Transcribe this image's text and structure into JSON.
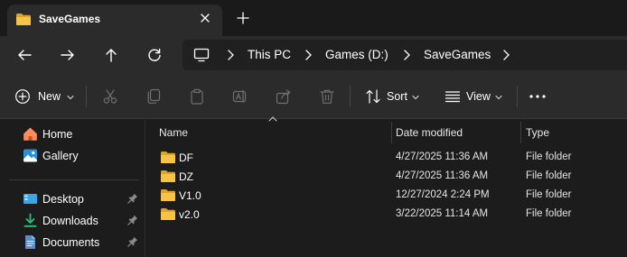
{
  "window": {
    "tab_title": "SaveGames",
    "tab_icon": "folder-icon",
    "colors": {
      "folder": "#f6c347",
      "folder_shade": "#dca52a",
      "accent": "#4cc2ff"
    }
  },
  "address": {
    "root_icon": "this-pc-icon",
    "crumbs": [
      "This PC",
      "Games (D:)",
      "SaveGames"
    ]
  },
  "toolbar": {
    "new_label": "New",
    "sort_label": "Sort",
    "view_label": "View"
  },
  "nav": {
    "quick": [
      {
        "label": "Home",
        "icon": "home-icon"
      },
      {
        "label": "Gallery",
        "icon": "gallery-icon"
      }
    ],
    "pinned": [
      {
        "label": "Desktop",
        "icon": "desktop-icon"
      },
      {
        "label": "Downloads",
        "icon": "downloads-icon"
      },
      {
        "label": "Documents",
        "icon": "documents-icon"
      }
    ]
  },
  "columns": {
    "name": "Name",
    "date": "Date modified",
    "type": "Type"
  },
  "files": [
    {
      "name": "DF",
      "date": "4/27/2025 11:36 AM",
      "type": "File folder"
    },
    {
      "name": "DZ",
      "date": "4/27/2025 11:36 AM",
      "type": "File folder"
    },
    {
      "name": "V1.0",
      "date": "12/27/2024 2:24 PM",
      "type": "File folder"
    },
    {
      "name": "v2.0",
      "date": "3/22/2025 11:14 AM",
      "type": "File folder"
    }
  ]
}
